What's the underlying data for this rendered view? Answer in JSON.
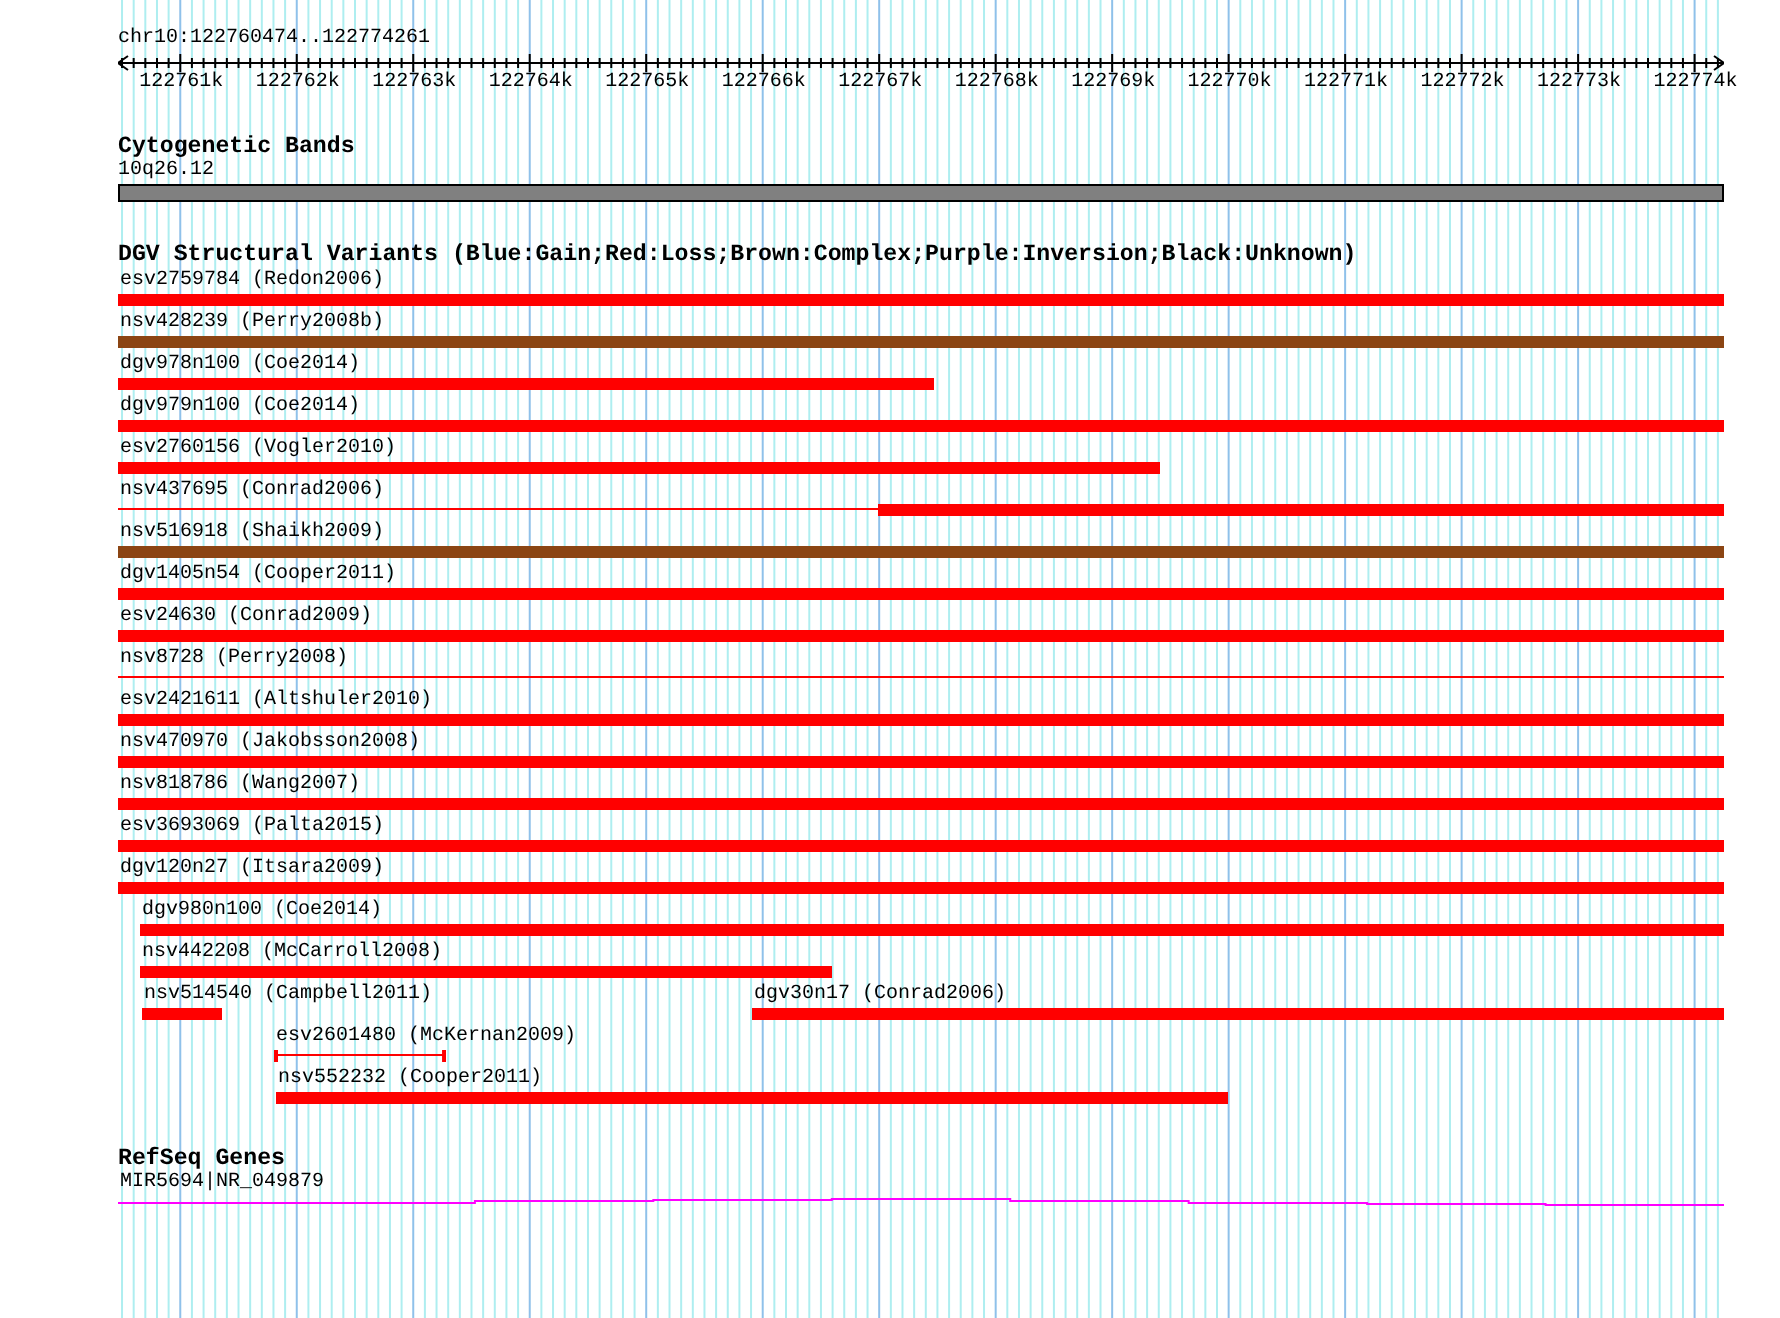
{
  "ruler": {
    "title": "chr10:122760474..122774261",
    "ticks": [
      "122761k",
      "122762k",
      "122763k",
      "122764k",
      "122765k",
      "122766k",
      "122767k",
      "122768k",
      "122769k",
      "122770k",
      "122771k",
      "122772k",
      "122773k",
      "122774k"
    ]
  },
  "cytobands": {
    "title": "Cytogenetic Bands",
    "band": "10q26.12"
  },
  "dgv": {
    "title": "DGV Structural Variants (Blue:Gain;Red:Loss;Brown:Complex;Purple:Inversion;Black:Unknown)",
    "rows": [
      {
        "features": [
          {
            "label": "esv2759784 (Redon2006)",
            "kind": "bar",
            "color": "#ff0000"
          }
        ]
      },
      {
        "features": [
          {
            "label": "nsv428239 (Perry2008b)",
            "kind": "bar",
            "color": "#8b4513"
          }
        ]
      },
      {
        "features": [
          {
            "label": "dgv978n100 (Coe2014)",
            "kind": "bar",
            "color": "#ff0000"
          }
        ]
      },
      {
        "features": [
          {
            "label": "dgv979n100 (Coe2014)",
            "kind": "bar",
            "color": "#ff0000"
          }
        ]
      },
      {
        "features": [
          {
            "label": "esv2760156 (Vogler2010)",
            "kind": "bar",
            "color": "#ff0000"
          }
        ]
      },
      {
        "features": [
          {
            "label": "nsv437695 (Conrad2006)",
            "kind": "partial",
            "color": "#ff0000"
          }
        ]
      },
      {
        "features": [
          {
            "label": "nsv516918 (Shaikh2009)",
            "kind": "bar",
            "color": "#8b4513"
          }
        ]
      },
      {
        "features": [
          {
            "label": "dgv1405n54 (Cooper2011)",
            "kind": "bar",
            "color": "#ff0000"
          }
        ]
      },
      {
        "features": [
          {
            "label": "esv24630 (Conrad2009)",
            "kind": "bar",
            "color": "#ff0000"
          }
        ]
      },
      {
        "features": [
          {
            "label": "nsv8728 (Perry2008)",
            "kind": "line",
            "color": "#ff0000"
          }
        ]
      },
      {
        "features": [
          {
            "label": "esv2421611 (Altshuler2010)",
            "kind": "bar",
            "color": "#ff0000"
          }
        ]
      },
      {
        "features": [
          {
            "label": "nsv470970 (Jakobsson2008)",
            "kind": "bar",
            "color": "#ff0000"
          }
        ]
      },
      {
        "features": [
          {
            "label": "nsv818786 (Wang2007)",
            "kind": "bar",
            "color": "#ff0000"
          }
        ]
      },
      {
        "features": [
          {
            "label": "esv3693069 (Palta2015)",
            "kind": "bar",
            "color": "#ff0000"
          }
        ]
      },
      {
        "features": [
          {
            "label": "dgv120n27 (Itsara2009)",
            "kind": "bar",
            "color": "#ff0000"
          }
        ]
      },
      {
        "features": [
          {
            "label": "dgv980n100 (Coe2014)",
            "kind": "bar",
            "color": "#ff0000"
          }
        ]
      },
      {
        "features": [
          {
            "label": "nsv442208 (McCarroll2008)",
            "kind": "bar",
            "color": "#ff0000"
          }
        ]
      },
      {
        "features": [
          {
            "label": "nsv514540 (Campbell2011)",
            "kind": "bar",
            "color": "#ff0000"
          },
          {
            "label": "dgv30n17 (Conrad2006)",
            "kind": "bar",
            "color": "#ff0000"
          }
        ]
      },
      {
        "features": [
          {
            "label": "esv2601480 (McKernan2009)",
            "kind": "interval",
            "color": "#ff0000"
          }
        ]
      },
      {
        "features": [
          {
            "label": "nsv552232 (Cooper2011)",
            "kind": "bar",
            "color": "#ff0000"
          }
        ]
      }
    ]
  },
  "refseq": {
    "title": "RefSeq Genes",
    "genes": [
      "MIR5694|NR_049879"
    ]
  }
}
